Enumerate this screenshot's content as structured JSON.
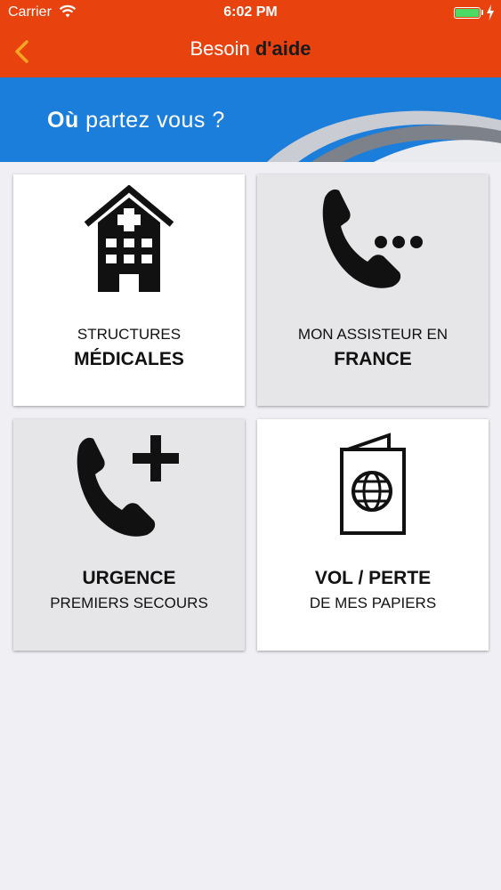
{
  "status_bar": {
    "carrier": "Carrier",
    "time": "6:02 PM"
  },
  "navbar": {
    "title_regular": "Besoin ",
    "title_bold": "d'aide"
  },
  "banner": {
    "text_bold": "Où",
    "text_regular": " partez vous ?"
  },
  "tiles": [
    {
      "line1": "STRUCTURES",
      "line2": "MÉDICALES",
      "icon": "hospital-icon"
    },
    {
      "line1": "MON ASSISTEUR EN",
      "line2": "FRANCE",
      "icon": "phone-dots-icon"
    },
    {
      "line1": "URGENCE",
      "line2": "PREMIERS SECOURS",
      "icon": "phone-plus-icon"
    },
    {
      "line1": "VOL / PERTE",
      "line2": "DE MES PAPIERS",
      "icon": "passport-icon"
    }
  ],
  "colors": {
    "header": "#e8420e",
    "banner": "#1c7edb",
    "back_arrow": "#f6a623"
  }
}
